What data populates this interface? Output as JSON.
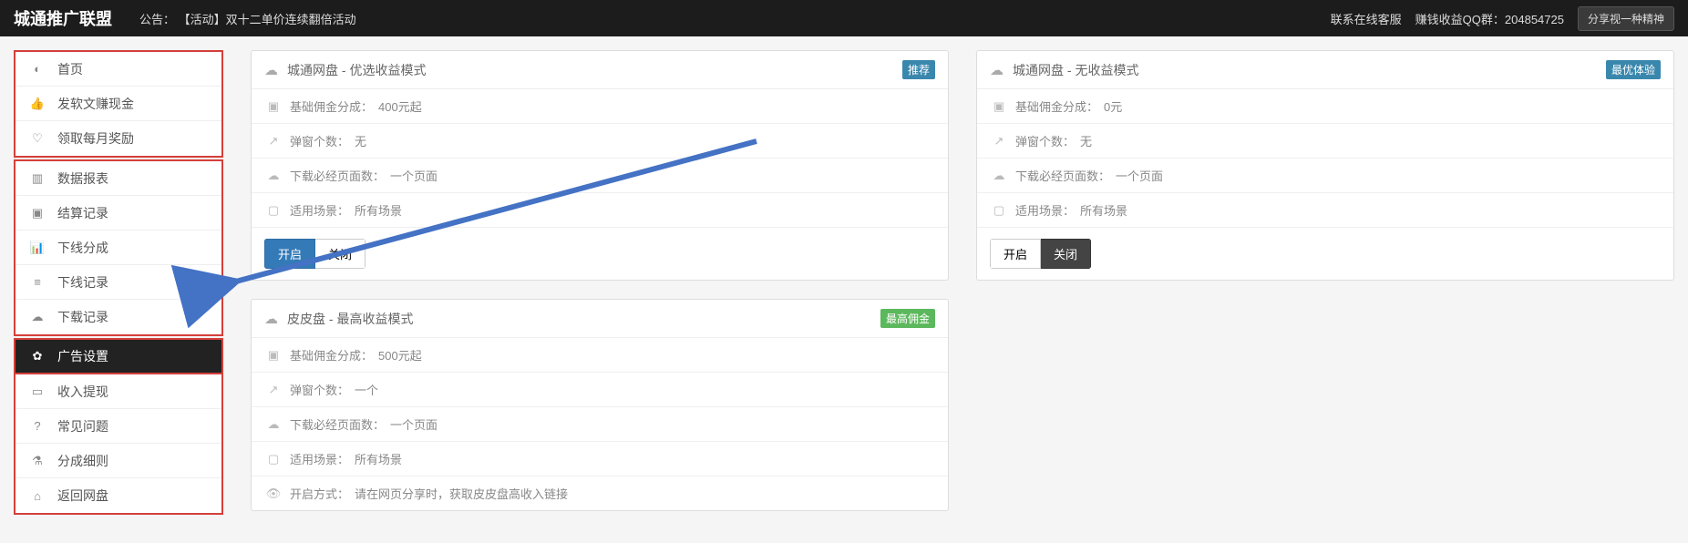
{
  "topbar": {
    "brand": "城通推广联盟",
    "announce_prefix": "公告：",
    "announce_link": "【活动】双十二单价连续翻倍活动",
    "contact": "联系在线客服",
    "qq_label": "赚钱收益QQ群：",
    "qq_value": "204854725",
    "share_btn": "分享视一种精神"
  },
  "sidebar": {
    "g0": {
      "i0": {
        "label": "首页"
      },
      "i1": {
        "label": "发软文赚现金"
      },
      "i2": {
        "label": "领取每月奖励"
      }
    },
    "g1": {
      "i0": {
        "label": "数据报表"
      },
      "i1": {
        "label": "结算记录"
      },
      "i2": {
        "label": "下线分成"
      },
      "i3": {
        "label": "下线记录"
      },
      "i4": {
        "label": "下载记录"
      }
    },
    "active": {
      "label": "广告设置"
    },
    "g2": {
      "i0": {
        "label": "收入提现"
      },
      "i1": {
        "label": "常见问题"
      },
      "i2": {
        "label": "分成细则"
      },
      "i3": {
        "label": "返回网盘"
      }
    }
  },
  "cards": {
    "c1": {
      "title": "城通网盘 - 优选收益模式",
      "tag": "推荐",
      "rows": {
        "r0": {
          "label": "基础佣金分成：",
          "val": "400元起"
        },
        "r1": {
          "label": "弹窗个数：",
          "val": "无"
        },
        "r2": {
          "label": "下载必经页面数：",
          "val": "一个页面"
        },
        "r3": {
          "label": "适用场景：",
          "val": "所有场景"
        }
      },
      "btn_on": "开启",
      "btn_off": "关闭"
    },
    "c2": {
      "title": "皮皮盘 - 最高收益模式",
      "tag": "最高佣金",
      "rows": {
        "r0": {
          "label": "基础佣金分成：",
          "val": "500元起"
        },
        "r1": {
          "label": "弹窗个数：",
          "val": "一个"
        },
        "r2": {
          "label": "下载必经页面数：",
          "val": "一个页面"
        },
        "r3": {
          "label": "适用场景：",
          "val": "所有场景"
        },
        "r4": {
          "label": "开启方式：",
          "val": "请在网页分享时，获取皮皮盘高收入链接"
        }
      }
    },
    "c3": {
      "title": "城通网盘 - 无收益模式",
      "tag": "最优体验",
      "rows": {
        "r0": {
          "label": "基础佣金分成：",
          "val": "0元"
        },
        "r1": {
          "label": "弹窗个数：",
          "val": "无"
        },
        "r2": {
          "label": "下载必经页面数：",
          "val": "一个页面"
        },
        "r3": {
          "label": "适用场景：",
          "val": "所有场景"
        }
      },
      "btn_on": "开启",
      "btn_off": "关闭"
    }
  }
}
